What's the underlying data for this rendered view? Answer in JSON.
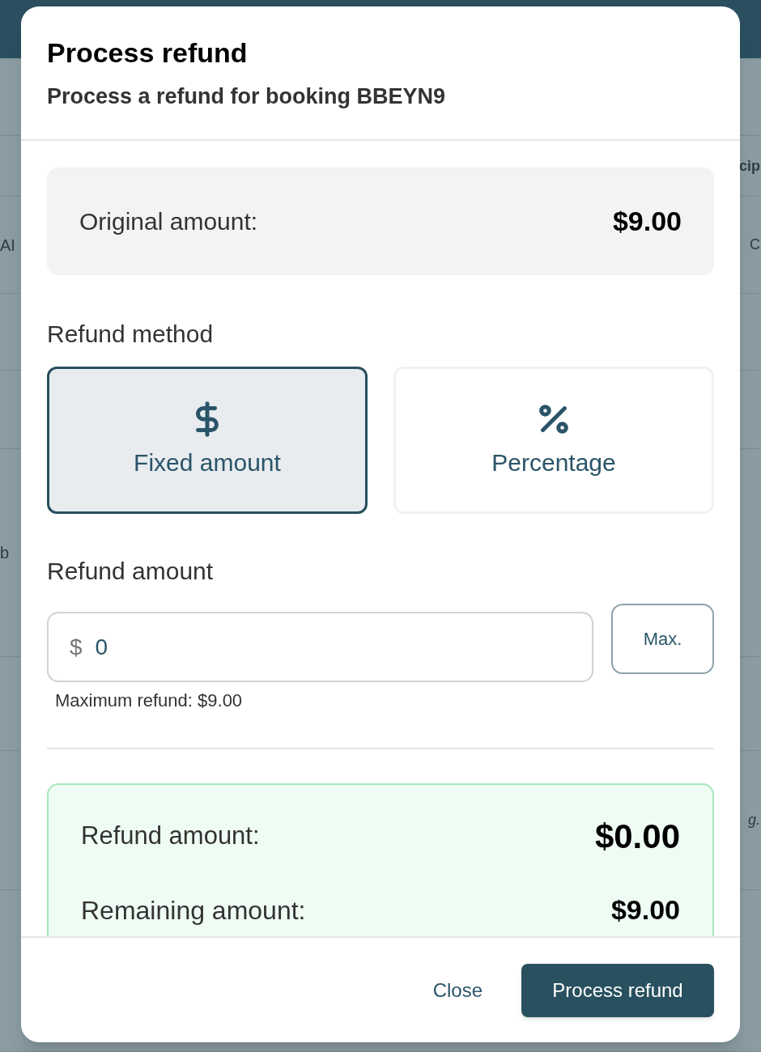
{
  "background": {
    "rows": [
      {
        "right": "cip",
        "right_bold": true
      },
      {
        "left": "AI",
        "right": "C"
      },
      {},
      {},
      {
        "left": "b"
      },
      {},
      {
        "right": "g.",
        "right_italic": true
      },
      {}
    ]
  },
  "dialog": {
    "title": "Process refund",
    "subtitle": "Process a refund for booking BBEYN9",
    "original": {
      "label": "Original amount:",
      "value": "$9.00"
    },
    "method": {
      "label": "Refund method",
      "options": [
        {
          "kind": "fixed",
          "label": "Fixed amount",
          "selected": true
        },
        {
          "kind": "percent",
          "label": "Percentage",
          "selected": false
        }
      ]
    },
    "amount": {
      "label": "Refund amount",
      "prefix": "$",
      "value": "0",
      "max_button": "Max.",
      "helper": "Maximum refund: $9.00"
    },
    "summary": [
      {
        "label": "Refund amount:",
        "value": "$0.00",
        "emphasis": true
      },
      {
        "label": "Remaining amount:",
        "value": "$9.00",
        "emphasis": false
      }
    ],
    "buttons": [
      {
        "kind": "text",
        "label": "Close"
      },
      {
        "kind": "primary",
        "label": "Process refund"
      }
    ]
  }
}
